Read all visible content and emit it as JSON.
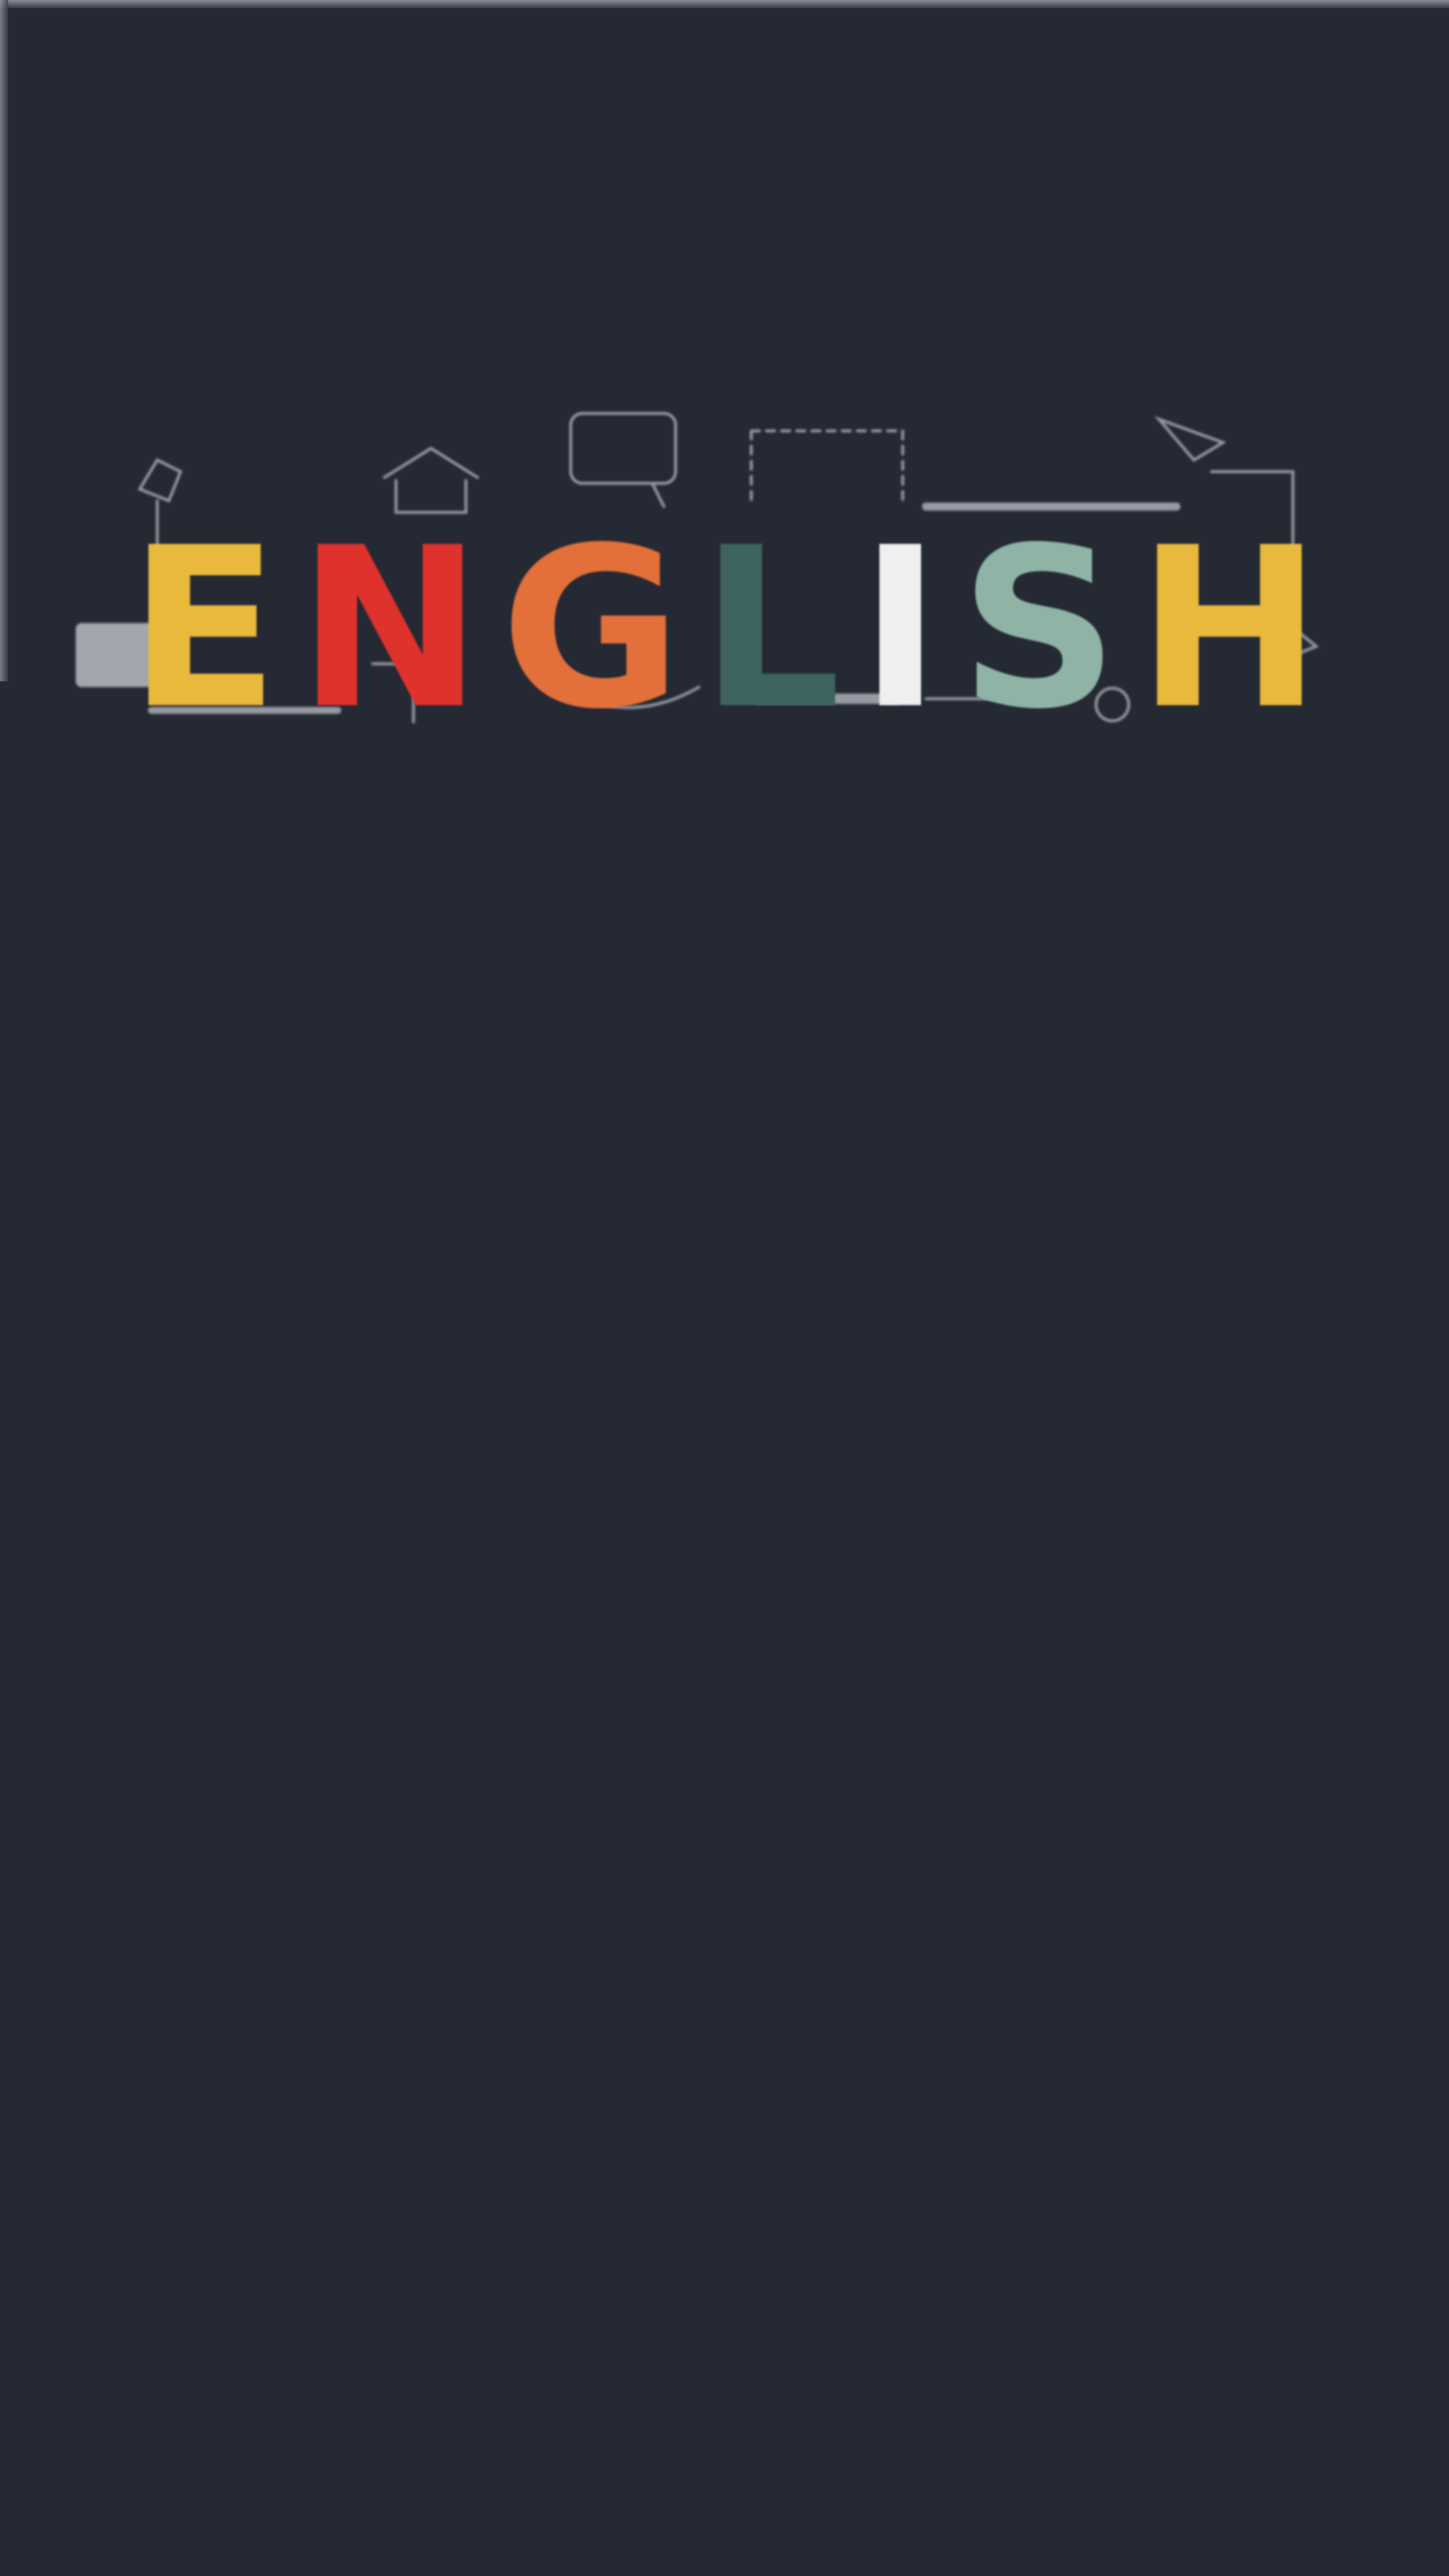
{
  "banner": {
    "letters": [
      {
        "char": "E",
        "color": "#e9b93c"
      },
      {
        "char": "N",
        "color": "#e0322d"
      },
      {
        "char": "G",
        "color": "#e3703a"
      },
      {
        "char": "L",
        "color": "#3e6460"
      },
      {
        "char": "I",
        "color": "#efefef"
      },
      {
        "char": "S",
        "color": "#8fb4a6"
      },
      {
        "char": "H",
        "color": "#e9b93c"
      }
    ]
  },
  "colors": {
    "background": "#252933",
    "doodle_line": "#c7cad1"
  }
}
